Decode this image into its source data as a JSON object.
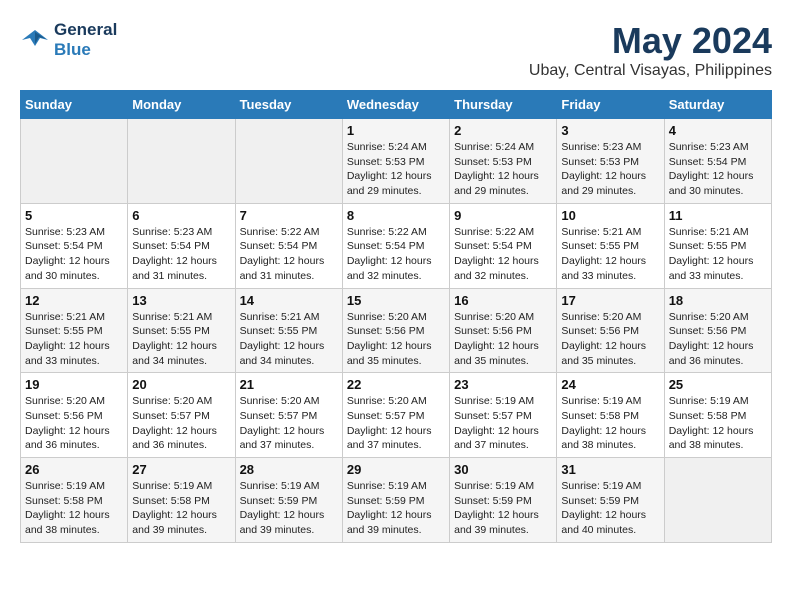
{
  "logo": {
    "line1": "General",
    "line2": "Blue"
  },
  "title": "May 2024",
  "subtitle": "Ubay, Central Visayas, Philippines",
  "weekdays": [
    "Sunday",
    "Monday",
    "Tuesday",
    "Wednesday",
    "Thursday",
    "Friday",
    "Saturday"
  ],
  "weeks": [
    [
      {
        "num": "",
        "sunrise": "",
        "sunset": "",
        "daylight": "",
        "empty": true
      },
      {
        "num": "",
        "sunrise": "",
        "sunset": "",
        "daylight": "",
        "empty": true
      },
      {
        "num": "",
        "sunrise": "",
        "sunset": "",
        "daylight": "",
        "empty": true
      },
      {
        "num": "1",
        "sunrise": "Sunrise: 5:24 AM",
        "sunset": "Sunset: 5:53 PM",
        "daylight": "Daylight: 12 hours and 29 minutes."
      },
      {
        "num": "2",
        "sunrise": "Sunrise: 5:24 AM",
        "sunset": "Sunset: 5:53 PM",
        "daylight": "Daylight: 12 hours and 29 minutes."
      },
      {
        "num": "3",
        "sunrise": "Sunrise: 5:23 AM",
        "sunset": "Sunset: 5:53 PM",
        "daylight": "Daylight: 12 hours and 29 minutes."
      },
      {
        "num": "4",
        "sunrise": "Sunrise: 5:23 AM",
        "sunset": "Sunset: 5:54 PM",
        "daylight": "Daylight: 12 hours and 30 minutes."
      }
    ],
    [
      {
        "num": "5",
        "sunrise": "Sunrise: 5:23 AM",
        "sunset": "Sunset: 5:54 PM",
        "daylight": "Daylight: 12 hours and 30 minutes."
      },
      {
        "num": "6",
        "sunrise": "Sunrise: 5:23 AM",
        "sunset": "Sunset: 5:54 PM",
        "daylight": "Daylight: 12 hours and 31 minutes."
      },
      {
        "num": "7",
        "sunrise": "Sunrise: 5:22 AM",
        "sunset": "Sunset: 5:54 PM",
        "daylight": "Daylight: 12 hours and 31 minutes."
      },
      {
        "num": "8",
        "sunrise": "Sunrise: 5:22 AM",
        "sunset": "Sunset: 5:54 PM",
        "daylight": "Daylight: 12 hours and 32 minutes."
      },
      {
        "num": "9",
        "sunrise": "Sunrise: 5:22 AM",
        "sunset": "Sunset: 5:54 PM",
        "daylight": "Daylight: 12 hours and 32 minutes."
      },
      {
        "num": "10",
        "sunrise": "Sunrise: 5:21 AM",
        "sunset": "Sunset: 5:55 PM",
        "daylight": "Daylight: 12 hours and 33 minutes."
      },
      {
        "num": "11",
        "sunrise": "Sunrise: 5:21 AM",
        "sunset": "Sunset: 5:55 PM",
        "daylight": "Daylight: 12 hours and 33 minutes."
      }
    ],
    [
      {
        "num": "12",
        "sunrise": "Sunrise: 5:21 AM",
        "sunset": "Sunset: 5:55 PM",
        "daylight": "Daylight: 12 hours and 33 minutes."
      },
      {
        "num": "13",
        "sunrise": "Sunrise: 5:21 AM",
        "sunset": "Sunset: 5:55 PM",
        "daylight": "Daylight: 12 hours and 34 minutes."
      },
      {
        "num": "14",
        "sunrise": "Sunrise: 5:21 AM",
        "sunset": "Sunset: 5:55 PM",
        "daylight": "Daylight: 12 hours and 34 minutes."
      },
      {
        "num": "15",
        "sunrise": "Sunrise: 5:20 AM",
        "sunset": "Sunset: 5:56 PM",
        "daylight": "Daylight: 12 hours and 35 minutes."
      },
      {
        "num": "16",
        "sunrise": "Sunrise: 5:20 AM",
        "sunset": "Sunset: 5:56 PM",
        "daylight": "Daylight: 12 hours and 35 minutes."
      },
      {
        "num": "17",
        "sunrise": "Sunrise: 5:20 AM",
        "sunset": "Sunset: 5:56 PM",
        "daylight": "Daylight: 12 hours and 35 minutes."
      },
      {
        "num": "18",
        "sunrise": "Sunrise: 5:20 AM",
        "sunset": "Sunset: 5:56 PM",
        "daylight": "Daylight: 12 hours and 36 minutes."
      }
    ],
    [
      {
        "num": "19",
        "sunrise": "Sunrise: 5:20 AM",
        "sunset": "Sunset: 5:56 PM",
        "daylight": "Daylight: 12 hours and 36 minutes."
      },
      {
        "num": "20",
        "sunrise": "Sunrise: 5:20 AM",
        "sunset": "Sunset: 5:57 PM",
        "daylight": "Daylight: 12 hours and 36 minutes."
      },
      {
        "num": "21",
        "sunrise": "Sunrise: 5:20 AM",
        "sunset": "Sunset: 5:57 PM",
        "daylight": "Daylight: 12 hours and 37 minutes."
      },
      {
        "num": "22",
        "sunrise": "Sunrise: 5:20 AM",
        "sunset": "Sunset: 5:57 PM",
        "daylight": "Daylight: 12 hours and 37 minutes."
      },
      {
        "num": "23",
        "sunrise": "Sunrise: 5:19 AM",
        "sunset": "Sunset: 5:57 PM",
        "daylight": "Daylight: 12 hours and 37 minutes."
      },
      {
        "num": "24",
        "sunrise": "Sunrise: 5:19 AM",
        "sunset": "Sunset: 5:58 PM",
        "daylight": "Daylight: 12 hours and 38 minutes."
      },
      {
        "num": "25",
        "sunrise": "Sunrise: 5:19 AM",
        "sunset": "Sunset: 5:58 PM",
        "daylight": "Daylight: 12 hours and 38 minutes."
      }
    ],
    [
      {
        "num": "26",
        "sunrise": "Sunrise: 5:19 AM",
        "sunset": "Sunset: 5:58 PM",
        "daylight": "Daylight: 12 hours and 38 minutes."
      },
      {
        "num": "27",
        "sunrise": "Sunrise: 5:19 AM",
        "sunset": "Sunset: 5:58 PM",
        "daylight": "Daylight: 12 hours and 39 minutes."
      },
      {
        "num": "28",
        "sunrise": "Sunrise: 5:19 AM",
        "sunset": "Sunset: 5:59 PM",
        "daylight": "Daylight: 12 hours and 39 minutes."
      },
      {
        "num": "29",
        "sunrise": "Sunrise: 5:19 AM",
        "sunset": "Sunset: 5:59 PM",
        "daylight": "Daylight: 12 hours and 39 minutes."
      },
      {
        "num": "30",
        "sunrise": "Sunrise: 5:19 AM",
        "sunset": "Sunset: 5:59 PM",
        "daylight": "Daylight: 12 hours and 39 minutes."
      },
      {
        "num": "31",
        "sunrise": "Sunrise: 5:19 AM",
        "sunset": "Sunset: 5:59 PM",
        "daylight": "Daylight: 12 hours and 40 minutes."
      },
      {
        "num": "",
        "sunrise": "",
        "sunset": "",
        "daylight": "",
        "empty": true
      }
    ]
  ]
}
